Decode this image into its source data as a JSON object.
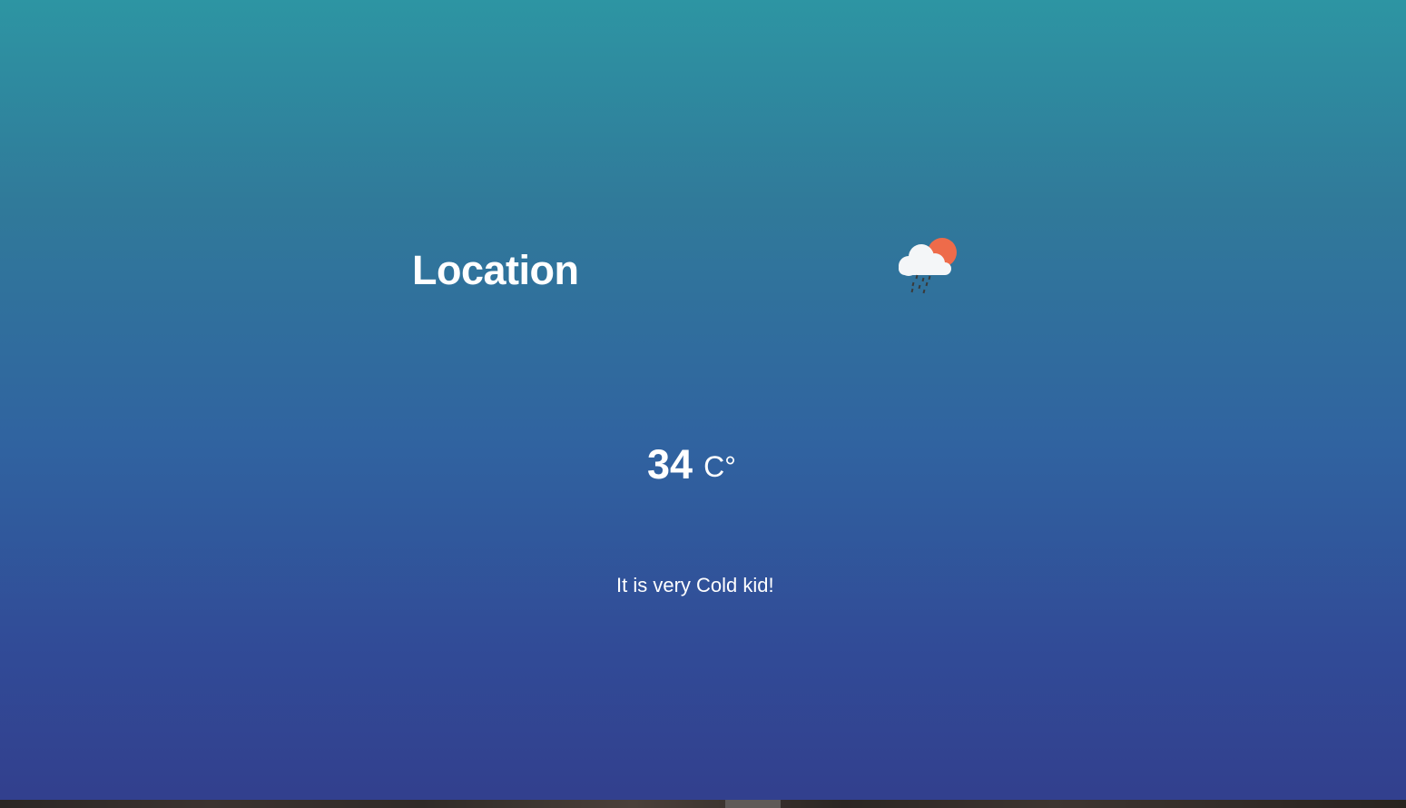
{
  "location": {
    "title": "Location"
  },
  "weather": {
    "icon": "cloud-rain-sun-icon",
    "icon_colors": {
      "sun": "#ee6b4a",
      "cloud": "#f4f6f8",
      "rain": "#3a3a3a"
    }
  },
  "temperature": {
    "value": "34",
    "unit": "C°"
  },
  "message": {
    "text": "It is very Cold kid!"
  },
  "colors": {
    "gradient_top": "#2d95a3",
    "gradient_bottom": "#323f8d",
    "text": "#ffffff"
  }
}
